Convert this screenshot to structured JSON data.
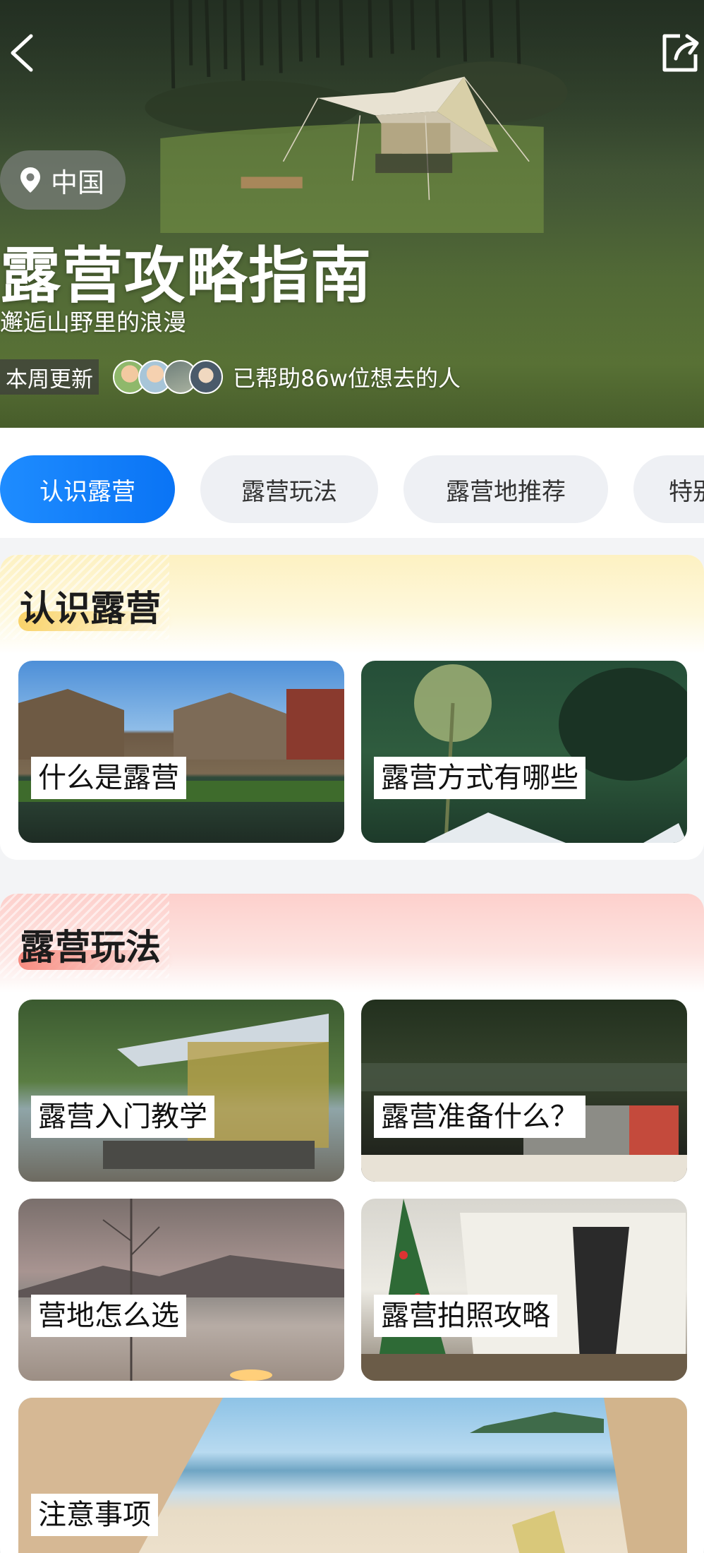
{
  "hero": {
    "location": "中国",
    "title": "露营攻略指南",
    "subtitle": "邂逅山野里的浪漫",
    "update_badge": "本周更新",
    "help_text": "已帮助86w位想去的人"
  },
  "tabs": [
    {
      "label": "认识露营",
      "active": true
    },
    {
      "label": "露营玩法",
      "active": false
    },
    {
      "label": "露营地推荐",
      "active": false
    },
    {
      "label": "特别",
      "active": false
    }
  ],
  "sections": [
    {
      "title": "认识露营",
      "tiles": [
        {
          "label": "什么是露营"
        },
        {
          "label": "露营方式有哪些"
        }
      ]
    },
    {
      "title": "露营玩法",
      "tiles": [
        {
          "label": "露营入门教学"
        },
        {
          "label": "露营准备什么？"
        },
        {
          "label": "营地怎么选"
        },
        {
          "label": "露营拍照攻略"
        },
        {
          "label": "注意事项"
        }
      ]
    }
  ],
  "colors": {
    "accent": "#1e8cff",
    "tab_bg": "#eef0f4",
    "section1_header": "#fdf1c2",
    "section2_header": "#fdd0cc"
  },
  "icons": [
    "back-arrow-icon",
    "share-icon",
    "location-pin-icon"
  ]
}
